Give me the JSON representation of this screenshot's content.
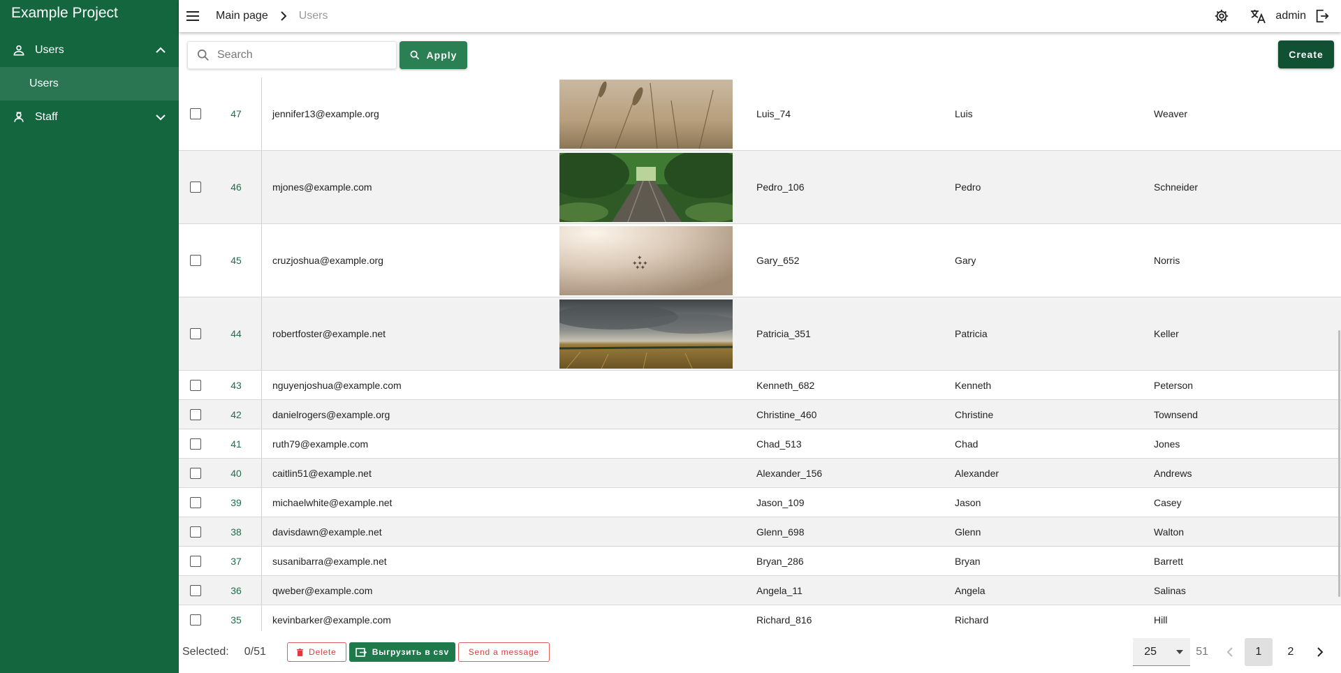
{
  "app": {
    "title": "Example Project"
  },
  "sidebar": {
    "groups": [
      {
        "label": "Users",
        "icon": "person-icon",
        "expanded": true,
        "items": [
          {
            "label": "Users"
          }
        ]
      },
      {
        "label": "Staff",
        "icon": "staff-icon",
        "expanded": false,
        "items": []
      }
    ]
  },
  "header": {
    "breadcrumb": {
      "main": "Main page",
      "current": "Users"
    },
    "user": "admin"
  },
  "toolbar": {
    "search_placeholder": "Search",
    "apply_label": "Apply",
    "create_label": "Create"
  },
  "table": {
    "rows": [
      {
        "id": "47",
        "email": "jennifer13@example.org",
        "username": "Luis_74",
        "first": "Luis",
        "last": "Weaver",
        "image": "wheat-photo"
      },
      {
        "id": "46",
        "email": "mjones@example.com",
        "username": "Pedro_106",
        "first": "Pedro",
        "last": "Schneider",
        "image": "railway-forest-photo"
      },
      {
        "id": "45",
        "email": "cruzjoshua@example.org",
        "username": "Gary_652",
        "first": "Gary",
        "last": "Norris",
        "image": "foggy-planes-photo"
      },
      {
        "id": "44",
        "email": "robertfoster@example.net",
        "username": "Patricia_351",
        "first": "Patricia",
        "last": "Keller",
        "image": "stormy-field-photo"
      },
      {
        "id": "43",
        "email": "nguyenjoshua@example.com",
        "username": "Kenneth_682",
        "first": "Kenneth",
        "last": "Peterson"
      },
      {
        "id": "42",
        "email": "danielrogers@example.org",
        "username": "Christine_460",
        "first": "Christine",
        "last": "Townsend"
      },
      {
        "id": "41",
        "email": "ruth79@example.com",
        "username": "Chad_513",
        "first": "Chad",
        "last": "Jones"
      },
      {
        "id": "40",
        "email": "caitlin51@example.net",
        "username": "Alexander_156",
        "first": "Alexander",
        "last": "Andrews"
      },
      {
        "id": "39",
        "email": "michaelwhite@example.net",
        "username": "Jason_109",
        "first": "Jason",
        "last": "Casey"
      },
      {
        "id": "38",
        "email": "davisdawn@example.net",
        "username": "Glenn_698",
        "first": "Glenn",
        "last": "Walton"
      },
      {
        "id": "37",
        "email": "susanibarra@example.net",
        "username": "Bryan_286",
        "first": "Bryan",
        "last": "Barrett"
      },
      {
        "id": "36",
        "email": "qweber@example.com",
        "username": "Angela_11",
        "first": "Angela",
        "last": "Salinas"
      },
      {
        "id": "35",
        "email": "kevinbarker@example.com",
        "username": "Richard_816",
        "first": "Richard",
        "last": "Hill"
      }
    ]
  },
  "footer": {
    "selected_label": "Selected:",
    "selected_count": "0/51",
    "delete_label": "Delete",
    "csv_label": "Выгрузить в csv",
    "message_label": "Send a message",
    "per_page": "25",
    "total": "51",
    "pages": [
      "1",
      "2"
    ],
    "current_page": "1"
  },
  "colors": {
    "sidebar": "#14663f",
    "accent": "#2a7f53",
    "danger": "#d93c3c"
  }
}
